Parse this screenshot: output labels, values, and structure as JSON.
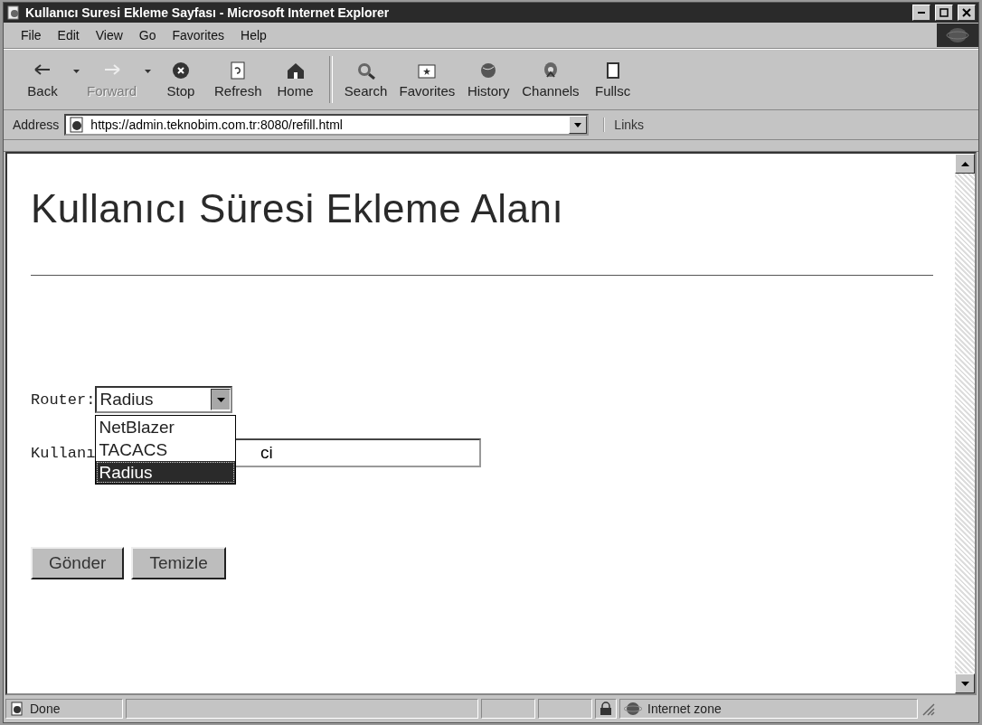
{
  "window": {
    "title": "Kullanıcı Suresi Ekleme Sayfası - Microsoft Internet Explorer"
  },
  "menu": [
    {
      "label": "File"
    },
    {
      "label": "Edit"
    },
    {
      "label": "View"
    },
    {
      "label": "Go"
    },
    {
      "label": "Favorites"
    },
    {
      "label": "Help"
    }
  ],
  "toolbar": [
    {
      "label": "Back",
      "kind": "back",
      "disabled": false,
      "dropdown": true
    },
    {
      "label": "Forward",
      "kind": "forward",
      "disabled": true,
      "dropdown": true
    },
    {
      "label": "Stop",
      "kind": "stop",
      "disabled": false,
      "dropdown": false
    },
    {
      "label": "Refresh",
      "kind": "refresh",
      "disabled": false,
      "dropdown": false
    },
    {
      "label": "Home",
      "kind": "home",
      "disabled": false,
      "dropdown": false
    },
    {
      "label": "Search",
      "kind": "search",
      "disabled": false,
      "dropdown": false
    },
    {
      "label": "Favorites",
      "kind": "favorites",
      "disabled": false,
      "dropdown": false
    },
    {
      "label": "History",
      "kind": "history",
      "disabled": false,
      "dropdown": false
    },
    {
      "label": "Channels",
      "kind": "channels",
      "disabled": false,
      "dropdown": false
    },
    {
      "label": "Fullsc",
      "kind": "fullscreen",
      "disabled": false,
      "dropdown": false
    }
  ],
  "address_bar": {
    "label": "Address",
    "value": "https://admin.teknobim.com.tr:8080/refill.html",
    "links": "Links"
  },
  "page": {
    "heading": "Kullanıcı Süresi Ekleme Alanı",
    "router_label": "Router:",
    "router_select": {
      "value": "Radius",
      "expanded": true,
      "options": [
        {
          "label": "NetBlazer",
          "selected": false
        },
        {
          "label": "TACACS",
          "selected": false
        },
        {
          "label": "Radius",
          "selected": true
        }
      ]
    },
    "user_label": "Kullanı",
    "user_field": {
      "value": "ci"
    },
    "buttons": [
      "Gönder",
      "Temizle"
    ]
  },
  "status_bar": {
    "text": "Done",
    "zone": "Internet zone"
  }
}
